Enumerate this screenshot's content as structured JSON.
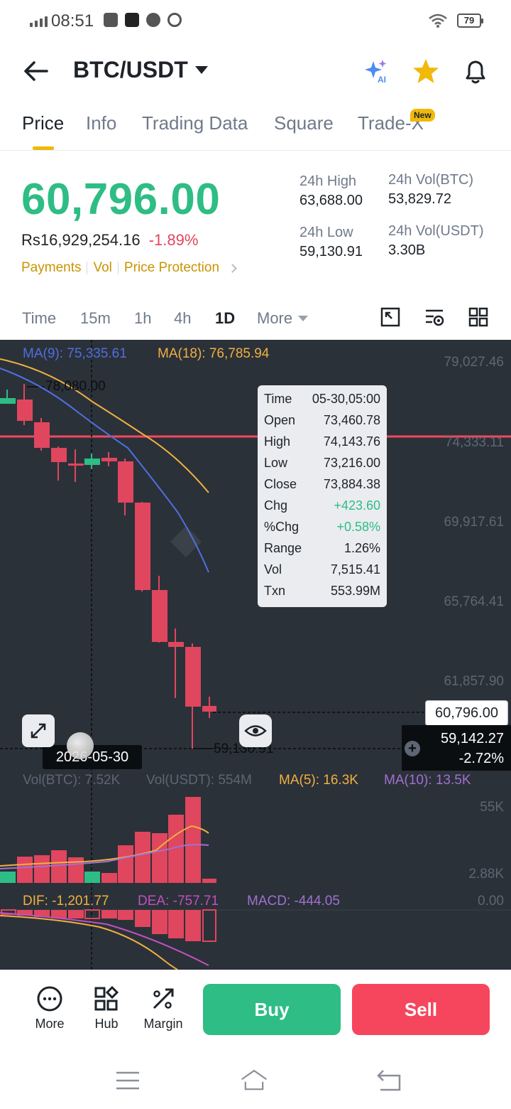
{
  "status_bar": {
    "time": "08:51",
    "battery": "79"
  },
  "header": {
    "pair": "BTC/USDT"
  },
  "tabs": [
    {
      "label": "Price"
    },
    {
      "label": "Info"
    },
    {
      "label": "Trading Data"
    },
    {
      "label": "Square"
    },
    {
      "label": "Trade-X"
    }
  ],
  "new_badge": "New",
  "ticker": {
    "last_price": "60,796.00",
    "fiat_price": "Rs16,929,254.16",
    "change_pct": "-1.89%",
    "high_label": "24h High",
    "high": "63,688.00",
    "low_label": "24h Low",
    "low": "59,130.91",
    "vol_btc_label": "24h Vol(BTC)",
    "vol_btc": "53,829.72",
    "vol_usdt_label": "24h Vol(USDT)",
    "vol_usdt": "3.30B"
  },
  "links": [
    "Payments",
    "Vol",
    "Price Protection"
  ],
  "intervals": [
    {
      "label": "Time"
    },
    {
      "label": "15m"
    },
    {
      "label": "1h"
    },
    {
      "label": "4h"
    },
    {
      "label": "1D"
    },
    {
      "label": "More"
    }
  ],
  "chart": {
    "ma9": "MA(9): 75,335.61",
    "ma18": "MA(18): 76,785.94",
    "y_labels": [
      "79,027.46",
      "74,333.11",
      "69,917.61",
      "65,764.41",
      "61,857.90"
    ],
    "high_marker": "78,080.00",
    "low_marker": "59,130.91",
    "current_price": "60,796.00",
    "cross_price": "59,142.27",
    "cross_change": "-2.72%",
    "cross_date": "2026-05-30",
    "vol_btc": "Vol(BTC): 7.52K",
    "vol_usdt": "Vol(USDT): 554M",
    "vol_ma5": "MA(5): 16.3K",
    "vol_ma10": "MA(10): 13.5K",
    "vol_y_top": "55K",
    "vol_y_bottom": "2.88K",
    "dif": "DIF: -1,201.77",
    "dea": "DEA: -757.71",
    "macd": "MACD: -444.05",
    "macd_y": "0.00",
    "colors": {
      "up": "#2ebd85",
      "down": "#e0465e",
      "ma9": "#4f6fe0",
      "ma18": "#f0b040",
      "ma10": "#a070d0"
    }
  },
  "tooltip": {
    "rows": [
      {
        "k": "Time",
        "v": "05-30,05:00"
      },
      {
        "k": "Open",
        "v": "73,460.78"
      },
      {
        "k": "High",
        "v": "74,143.76"
      },
      {
        "k": "Low",
        "v": "73,216.00"
      },
      {
        "k": "Close",
        "v": "73,884.38"
      },
      {
        "k": "Chg",
        "v": "+423.60"
      },
      {
        "k": "%Chg",
        "v": "+0.58%"
      },
      {
        "k": "Range",
        "v": "1.26%"
      },
      {
        "k": "Vol",
        "v": "7,515.41"
      },
      {
        "k": "Txn",
        "v": "553.99M"
      }
    ]
  },
  "bottom": {
    "more": "More",
    "hub": "Hub",
    "margin": "Margin",
    "buy": "Buy",
    "sell": "Sell"
  }
}
